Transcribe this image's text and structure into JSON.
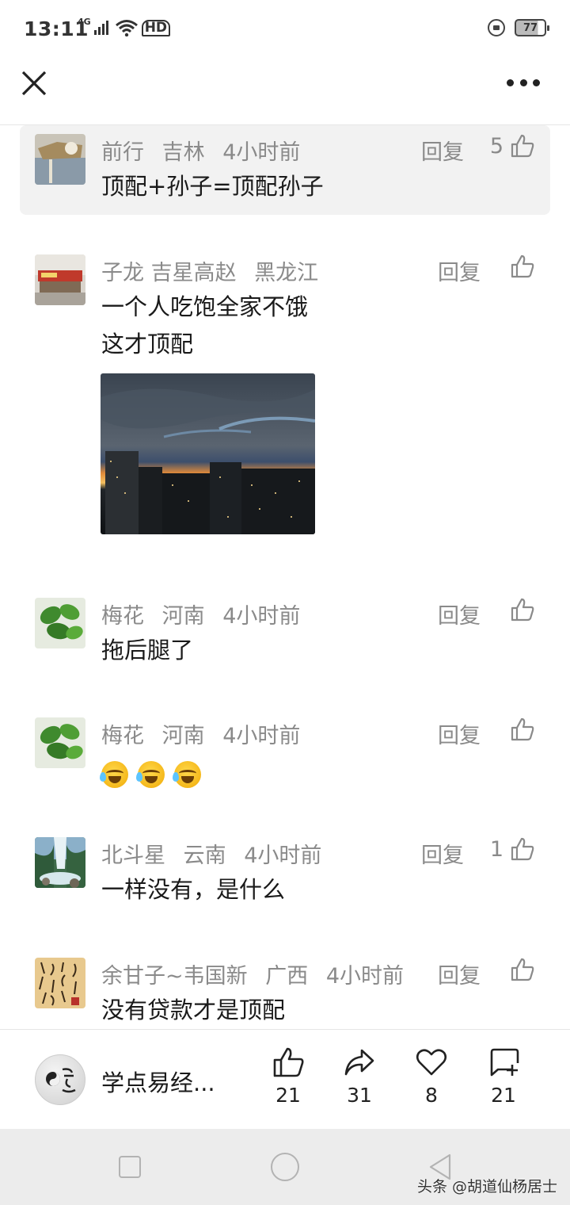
{
  "status_bar": {
    "time": "13:11",
    "network": "4G",
    "hd": "HD",
    "battery": "77"
  },
  "nav": {
    "close_icon": "close-icon",
    "more_icon": "more-icon"
  },
  "comments": [
    {
      "user": "前行",
      "location": "吉林",
      "time": "4小时前",
      "reply_label": "回复",
      "likes": "5",
      "text": "顶配+孙子=顶配孙子",
      "highlighted": true
    },
    {
      "user": "子龙  吉星高赵",
      "location": "黑龙江",
      "time": "",
      "reply_label": "回复",
      "likes": "",
      "text_lines": [
        "一个人吃饱全家不饿",
        "这才顶配"
      ],
      "has_image": true
    },
    {
      "user": "梅花",
      "location": "河南",
      "time": "4小时前",
      "reply_label": "回复",
      "likes": "",
      "text": "拖后腿了"
    },
    {
      "user": "梅花",
      "location": "河南",
      "time": "4小时前",
      "reply_label": "回复",
      "likes": "",
      "emoji_count": 3,
      "emoji": "laughing-crying-emoji"
    },
    {
      "user": "北斗星",
      "location": "云南",
      "time": "4小时前",
      "reply_label": "回复",
      "likes": "1",
      "text": "一样没有，是什么"
    },
    {
      "user": "余甘子~韦国新",
      "location": "广西",
      "time": "4小时前",
      "reply_label": "回复",
      "likes": "",
      "text": "没有贷款才是顶配"
    }
  ],
  "action_bar": {
    "author": "学点易经...",
    "like_count": "21",
    "share_count": "31",
    "favorite_count": "8",
    "comment_count": "21"
  },
  "watermark": "头条 @胡道仙杨居士",
  "colors": {
    "meta_gray": "#8a8a8a",
    "highlight_bg": "#f2f2f2",
    "sys_nav_bg": "#ececec"
  }
}
